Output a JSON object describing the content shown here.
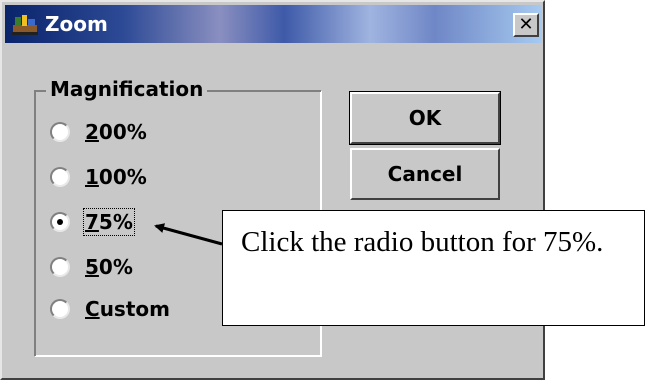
{
  "dialog": {
    "title": "Zoom",
    "close_glyph": "✕",
    "app_icon": "app-icon",
    "group_label": "Magnification",
    "options": [
      {
        "mnemonic": "2",
        "rest": "00%",
        "checked": false
      },
      {
        "mnemonic": "1",
        "rest": "00%",
        "checked": false
      },
      {
        "mnemonic": "7",
        "rest": "5%",
        "checked": true
      },
      {
        "mnemonic": "5",
        "rest": "0%",
        "checked": false
      },
      {
        "mnemonic": "C",
        "rest": "ustom",
        "checked": false
      }
    ],
    "ok_label": "OK",
    "cancel_label": "Cancel"
  },
  "callout": {
    "text": "Click the radio button for 75%."
  },
  "colors": {
    "title_gradient_start": "#0a246a",
    "title_gradient_end": "#a6caf0",
    "face": "#c8c8c8"
  }
}
